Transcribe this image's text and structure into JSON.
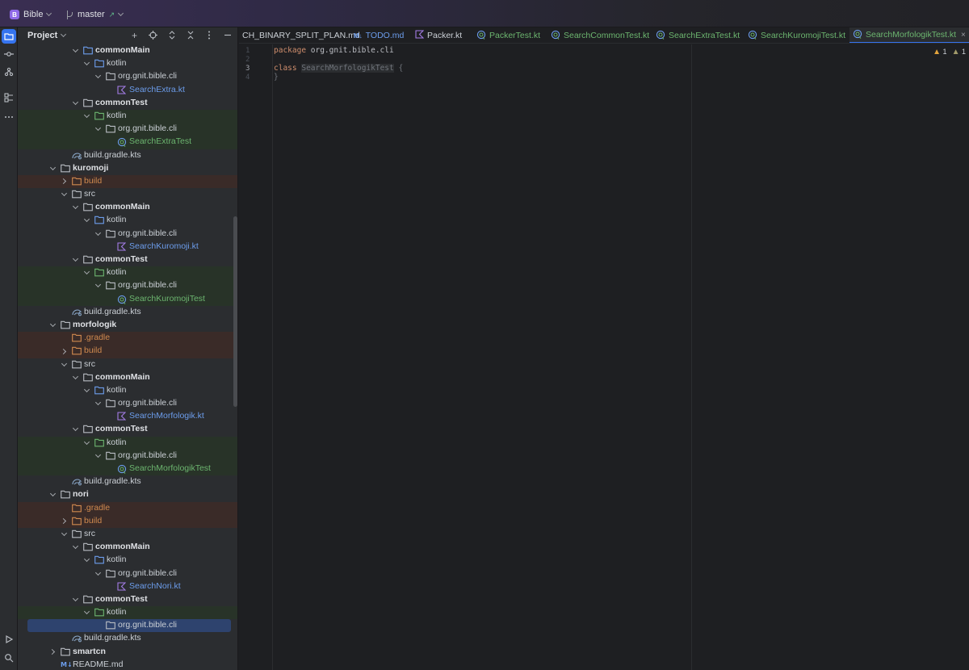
{
  "titlebar": {
    "project_badge": "B",
    "project_name": "Bible",
    "branch": "master",
    "branch_arrow": "↗"
  },
  "project_panel": {
    "title": "Project",
    "tree": [
      {
        "depth": 6,
        "arrow": "down",
        "icon": "folder-blue",
        "label": "commonMain",
        "style": "bold",
        "bg": ""
      },
      {
        "depth": 7,
        "arrow": "down",
        "icon": "folder-blue",
        "label": "kotlin",
        "style": "default",
        "bg": ""
      },
      {
        "depth": 8,
        "arrow": "down",
        "icon": "folder-gray",
        "label": "org.gnit.bible.cli",
        "style": "default",
        "bg": ""
      },
      {
        "depth": 9,
        "arrow": "",
        "icon": "kotlin-file",
        "label": "SearchExtra.kt",
        "style": "blue",
        "bg": ""
      },
      {
        "depth": 6,
        "arrow": "down",
        "icon": "folder-gray",
        "label": "commonTest",
        "style": "bold",
        "bg": ""
      },
      {
        "depth": 7,
        "arrow": "down",
        "icon": "folder-green",
        "label": "kotlin",
        "style": "default",
        "bg": "test"
      },
      {
        "depth": 8,
        "arrow": "down",
        "icon": "folder-gray",
        "label": "org.gnit.bible.cli",
        "style": "default",
        "bg": "test"
      },
      {
        "depth": 9,
        "arrow": "",
        "icon": "test-file",
        "label": "SearchExtraTest",
        "style": "green",
        "bg": "test"
      },
      {
        "depth": 5,
        "arrow": "",
        "icon": "gradle-file",
        "label": "build.gradle.kts",
        "style": "default",
        "bg": ""
      },
      {
        "depth": 4,
        "arrow": "down",
        "icon": "folder-gray",
        "label": "kuromoji",
        "style": "bold",
        "bg": ""
      },
      {
        "depth": 5,
        "arrow": "right",
        "icon": "folder-orange",
        "label": "build",
        "style": "orange",
        "bg": "excl"
      },
      {
        "depth": 5,
        "arrow": "down",
        "icon": "folder-gray",
        "label": "src",
        "style": "default",
        "bg": ""
      },
      {
        "depth": 6,
        "arrow": "down",
        "icon": "folder-gray",
        "label": "commonMain",
        "style": "bold",
        "bg": ""
      },
      {
        "depth": 7,
        "arrow": "down",
        "icon": "folder-blue",
        "label": "kotlin",
        "style": "default",
        "bg": ""
      },
      {
        "depth": 8,
        "arrow": "down",
        "icon": "folder-gray",
        "label": "org.gnit.bible.cli",
        "style": "default",
        "bg": ""
      },
      {
        "depth": 9,
        "arrow": "",
        "icon": "kotlin-file",
        "label": "SearchKuromoji.kt",
        "style": "blue",
        "bg": ""
      },
      {
        "depth": 6,
        "arrow": "down",
        "icon": "folder-gray",
        "label": "commonTest",
        "style": "bold",
        "bg": ""
      },
      {
        "depth": 7,
        "arrow": "down",
        "icon": "folder-green",
        "label": "kotlin",
        "style": "default",
        "bg": "test"
      },
      {
        "depth": 8,
        "arrow": "down",
        "icon": "folder-gray",
        "label": "org.gnit.bible.cli",
        "style": "default",
        "bg": "test"
      },
      {
        "depth": 9,
        "arrow": "",
        "icon": "test-file",
        "label": "SearchKuromojiTest",
        "style": "green",
        "bg": "test"
      },
      {
        "depth": 5,
        "arrow": "",
        "icon": "gradle-file",
        "label": "build.gradle.kts",
        "style": "default",
        "bg": ""
      },
      {
        "depth": 4,
        "arrow": "down",
        "icon": "folder-gray",
        "label": "morfologik",
        "style": "bold",
        "bg": ""
      },
      {
        "depth": 5,
        "arrow": "",
        "icon": "folder-orange",
        "label": ".gradle",
        "style": "orange",
        "bg": "excl"
      },
      {
        "depth": 5,
        "arrow": "right",
        "icon": "folder-orange",
        "label": "build",
        "style": "orange",
        "bg": "excl"
      },
      {
        "depth": 5,
        "arrow": "down",
        "icon": "folder-gray",
        "label": "src",
        "style": "default",
        "bg": ""
      },
      {
        "depth": 6,
        "arrow": "down",
        "icon": "folder-gray",
        "label": "commonMain",
        "style": "bold",
        "bg": ""
      },
      {
        "depth": 7,
        "arrow": "down",
        "icon": "folder-blue",
        "label": "kotlin",
        "style": "default",
        "bg": ""
      },
      {
        "depth": 8,
        "arrow": "down",
        "icon": "folder-gray",
        "label": "org.gnit.bible.cli",
        "style": "default",
        "bg": ""
      },
      {
        "depth": 9,
        "arrow": "",
        "icon": "kotlin-file",
        "label": "SearchMorfologik.kt",
        "style": "blue",
        "bg": ""
      },
      {
        "depth": 6,
        "arrow": "down",
        "icon": "folder-gray",
        "label": "commonTest",
        "style": "bold",
        "bg": ""
      },
      {
        "depth": 7,
        "arrow": "down",
        "icon": "folder-green",
        "label": "kotlin",
        "style": "default",
        "bg": "test"
      },
      {
        "depth": 8,
        "arrow": "down",
        "icon": "folder-gray",
        "label": "org.gnit.bible.cli",
        "style": "default",
        "bg": "test"
      },
      {
        "depth": 9,
        "arrow": "",
        "icon": "test-file",
        "label": "SearchMorfologikTest",
        "style": "green",
        "bg": "test"
      },
      {
        "depth": 5,
        "arrow": "",
        "icon": "gradle-file",
        "label": "build.gradle.kts",
        "style": "default",
        "bg": ""
      },
      {
        "depth": 4,
        "arrow": "down",
        "icon": "folder-gray",
        "label": "nori",
        "style": "bold",
        "bg": ""
      },
      {
        "depth": 5,
        "arrow": "",
        "icon": "folder-orange",
        "label": ".gradle",
        "style": "orange",
        "bg": "excl"
      },
      {
        "depth": 5,
        "arrow": "right",
        "icon": "folder-orange",
        "label": "build",
        "style": "orange",
        "bg": "excl"
      },
      {
        "depth": 5,
        "arrow": "down",
        "icon": "folder-gray",
        "label": "src",
        "style": "default",
        "bg": ""
      },
      {
        "depth": 6,
        "arrow": "down",
        "icon": "folder-gray",
        "label": "commonMain",
        "style": "bold",
        "bg": ""
      },
      {
        "depth": 7,
        "arrow": "down",
        "icon": "folder-blue",
        "label": "kotlin",
        "style": "default",
        "bg": ""
      },
      {
        "depth": 8,
        "arrow": "down",
        "icon": "folder-gray",
        "label": "org.gnit.bible.cli",
        "style": "default",
        "bg": ""
      },
      {
        "depth": 9,
        "arrow": "",
        "icon": "kotlin-file",
        "label": "SearchNori.kt",
        "style": "blue",
        "bg": ""
      },
      {
        "depth": 6,
        "arrow": "down",
        "icon": "folder-gray",
        "label": "commonTest",
        "style": "bold",
        "bg": ""
      },
      {
        "depth": 7,
        "arrow": "down",
        "icon": "folder-green",
        "label": "kotlin",
        "style": "default",
        "bg": "test"
      },
      {
        "depth": 8,
        "arrow": "",
        "icon": "folder-gray",
        "label": "org.gnit.bible.cli",
        "style": "default",
        "bg": "sel"
      },
      {
        "depth": 5,
        "arrow": "",
        "icon": "gradle-file",
        "label": "build.gradle.kts",
        "style": "default",
        "bg": ""
      },
      {
        "depth": 4,
        "arrow": "right",
        "icon": "folder-gray",
        "label": "smartcn",
        "style": "bold",
        "bg": ""
      },
      {
        "depth": 4,
        "arrow": "",
        "icon": "md-file",
        "label": "README.md",
        "style": "default",
        "bg": ""
      }
    ]
  },
  "tabs": [
    {
      "label": "CH_BINARY_SPLIT_PLAN.md",
      "icon": "none",
      "color": "default",
      "active": false
    },
    {
      "label": "TODO.md",
      "icon": "md",
      "color": "blue",
      "active": false
    },
    {
      "label": "Packer.kt",
      "icon": "kotlin",
      "color": "default",
      "active": false
    },
    {
      "label": "PackerTest.kt",
      "icon": "test",
      "color": "green",
      "active": false
    },
    {
      "label": "SearchCommonTest.kt",
      "icon": "test",
      "color": "green",
      "active": false
    },
    {
      "label": "SearchExtraTest.kt",
      "icon": "test",
      "color": "green",
      "active": false
    },
    {
      "label": "SearchKuromojiTest.kt",
      "icon": "test",
      "color": "green",
      "active": false
    },
    {
      "label": "SearchMorfologikTest.kt",
      "icon": "test",
      "color": "green",
      "active": true
    }
  ],
  "editor": {
    "line_numbers": [
      "1",
      "2",
      "3",
      "4"
    ],
    "current_line": 3,
    "code": {
      "line1_kw": "package",
      "line1_rest": " org.gnit.bible.cli",
      "line3_kw": "class",
      "line3_name": "SearchMorfologikTest",
      "line3_brace": " {",
      "line4": "}"
    },
    "inspections": {
      "warnings": "1",
      "weak_warnings": "1"
    }
  },
  "colors": {
    "accent": "#3574f0",
    "test_green": "#6cb56f",
    "source_blue": "#6c9dec",
    "excluded_orange": "#d08a4f"
  }
}
